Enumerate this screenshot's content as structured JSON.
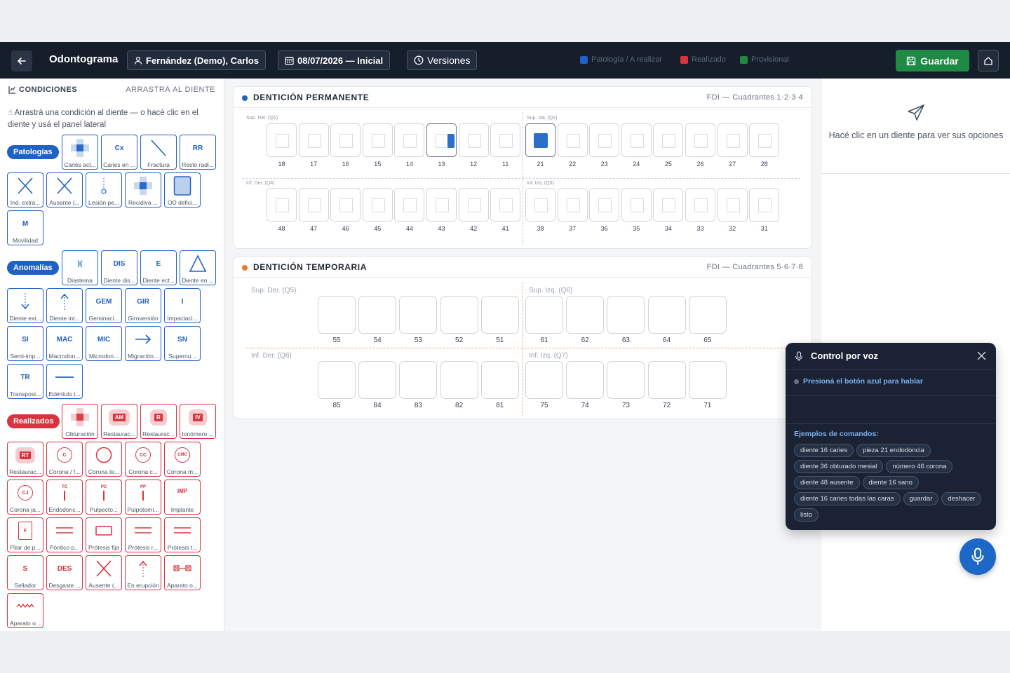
{
  "header": {
    "title": "Odontograma",
    "patient": "Fernández (Demo), Carlos",
    "session": "08/07/2026 — Inicial",
    "versions": "Versiones",
    "legend": [
      {
        "label": "Patología / A realizar",
        "color": "#1f62c4"
      },
      {
        "label": "Realizado",
        "color": "#d9333f"
      },
      {
        "label": "Provisional",
        "color": "#1f8a3f"
      }
    ],
    "save": "Guardar"
  },
  "sidebar": {
    "title": "CONDICIONES",
    "hint_right": "ARRASTRÁ AL DIENTE",
    "instructions": "Arrastrá una condición al diente — o hacé clic en el diente y usá el panel lateral",
    "categories": [
      {
        "name": "Patologías",
        "color": "#1f62c4"
      },
      {
        "name": "Anomalías",
        "color": "#1f62c4"
      },
      {
        "name": "Realizados",
        "color": "#d9333f"
      }
    ],
    "patologias": [
      {
        "label": "Caries act...",
        "icon": "caries-grid-icon"
      },
      {
        "label": "Caries en ...",
        "code": "Cx"
      },
      {
        "label": "Fractura",
        "icon": "fracture-line-icon"
      },
      {
        "label": "Resto radi...",
        "code": "RR"
      },
      {
        "label": "Ind. extra...",
        "icon": "x-mark-icon"
      },
      {
        "label": "Ausente (...",
        "icon": "x-mark-icon"
      },
      {
        "label": "Lesión pe...",
        "icon": "lesion-icon"
      },
      {
        "label": "Recidiva ...",
        "icon": "caries-grid-icon"
      },
      {
        "label": "OD defici...",
        "icon": "filled-square-icon"
      },
      {
        "label": "Movilidad",
        "code": "M"
      }
    ],
    "anomalias": [
      {
        "label": "Diastema",
        "code": ")("
      },
      {
        "label": "Diente dis...",
        "code": "DIS"
      },
      {
        "label": "Diente ect...",
        "code": "E"
      },
      {
        "label": "Diente en ...",
        "icon": "triangle-icon"
      },
      {
        "label": "Diente ext...",
        "icon": "arrow-down-icon"
      },
      {
        "label": "Diente int...",
        "icon": "arrow-up-icon"
      },
      {
        "label": "Geminaci...",
        "code": "GEM"
      },
      {
        "label": "Giroversión",
        "code": "GIR"
      },
      {
        "label": "Impactaci...",
        "code": "I"
      },
      {
        "label": "Semi-imp...",
        "code": "SI"
      },
      {
        "label": "Macrodon...",
        "code": "MAC"
      },
      {
        "label": "Microdon...",
        "code": "MIC"
      },
      {
        "label": "Migración...",
        "icon": "arrow-right-icon"
      },
      {
        "label": "Supernu...",
        "code": "SN"
      },
      {
        "label": "Transposi...",
        "code": "TR"
      },
      {
        "label": "Edéntulo t...",
        "icon": "horizontal-line-icon"
      }
    ],
    "realizados": [
      {
        "label": "Obturación",
        "icon": "filled-cross-icon"
      },
      {
        "label": "Restaurac...",
        "code": "AM"
      },
      {
        "label": "Restaurac...",
        "code": "R"
      },
      {
        "label": "Ionómero ...",
        "code": "IV"
      },
      {
        "label": "Restaurac...",
        "code": "RT"
      },
      {
        "label": "Corona / f...",
        "code": "C"
      },
      {
        "label": "Corona te...",
        "icon": "circle-icon"
      },
      {
        "label": "Corona c...",
        "code": "CC"
      },
      {
        "label": "Corona m...",
        "code": "CMC"
      },
      {
        "label": "Corona ja...",
        "code": "CJ"
      },
      {
        "label": "Endodonc...",
        "code": "TC"
      },
      {
        "label": "Pulpecto...",
        "code": "PC"
      },
      {
        "label": "Pulpotomí...",
        "code": "PP"
      },
      {
        "label": "Implante",
        "code": "IMP"
      },
      {
        "label": "Pilar de p...",
        "code": "F"
      },
      {
        "label": "Póntico p...",
        "icon": "double-line-icon"
      },
      {
        "label": "Prótesis fija",
        "icon": "rectangle-icon"
      },
      {
        "label": "Prótesis r...",
        "icon": "double-line-icon"
      },
      {
        "label": "Prótesis t...",
        "icon": "double-line-icon"
      },
      {
        "label": "Sellador",
        "code": "S"
      },
      {
        "label": "Desgaste ...",
        "code": "DES"
      },
      {
        "label": "Ausente (...",
        "icon": "x-mark-icon"
      },
      {
        "label": "En erupción",
        "icon": "arrow-up-icon"
      },
      {
        "label": "Aparato o...",
        "icon": "bracket-icon"
      },
      {
        "label": "Aparato o...",
        "icon": "wave-icon"
      }
    ]
  },
  "permanent": {
    "title": "DENTICIÓN PERMANENTE",
    "subtitle": "FDI — Cuadrantes 1·2·3·4",
    "quadrants": [
      "Sup. Der. (Q1)",
      "Sup. Izq. (Q2)",
      "Inf. Der. (Q4)",
      "Inf. Izq. (Q3)"
    ],
    "upper": [
      "18",
      "17",
      "16",
      "15",
      "14",
      "13",
      "12",
      "11",
      "21",
      "22",
      "23",
      "24",
      "25",
      "26",
      "27",
      "28"
    ],
    "lower": [
      "48",
      "47",
      "46",
      "45",
      "44",
      "43",
      "42",
      "41",
      "38",
      "37",
      "36",
      "35",
      "34",
      "33",
      "32",
      "31"
    ]
  },
  "temporary": {
    "title": "DENTICIÓN TEMPORARIA",
    "subtitle": "FDI — Cuadrantes 5·6·7·8",
    "quadrants": [
      "Sup. Der. (Q5)",
      "Sup. Izq. (Q6)",
      "Inf. Der. (Q8)",
      "Inf. Izq. (Q7)"
    ],
    "upper": [
      "55",
      "54",
      "53",
      "52",
      "51",
      "61",
      "62",
      "63",
      "64",
      "65"
    ],
    "lower": [
      "85",
      "84",
      "83",
      "82",
      "81",
      "75",
      "74",
      "73",
      "72",
      "71"
    ]
  },
  "side_panel": {
    "message": "Hacé clic en un diente para ver sus opciones"
  },
  "voice": {
    "title": "Control por voz",
    "status": "Presioná el botón azul para hablar",
    "examples_title": "Ejemplos de comandos:",
    "examples": [
      "diente 16 caries",
      "pieza 21 endodoncia",
      "diente 36 obturado mesial",
      "número 46 corona",
      "diente 48 ausente",
      "diente 16 sano",
      "diente 16 caries todas las caras",
      "guardar",
      "deshacer",
      "listo"
    ]
  }
}
